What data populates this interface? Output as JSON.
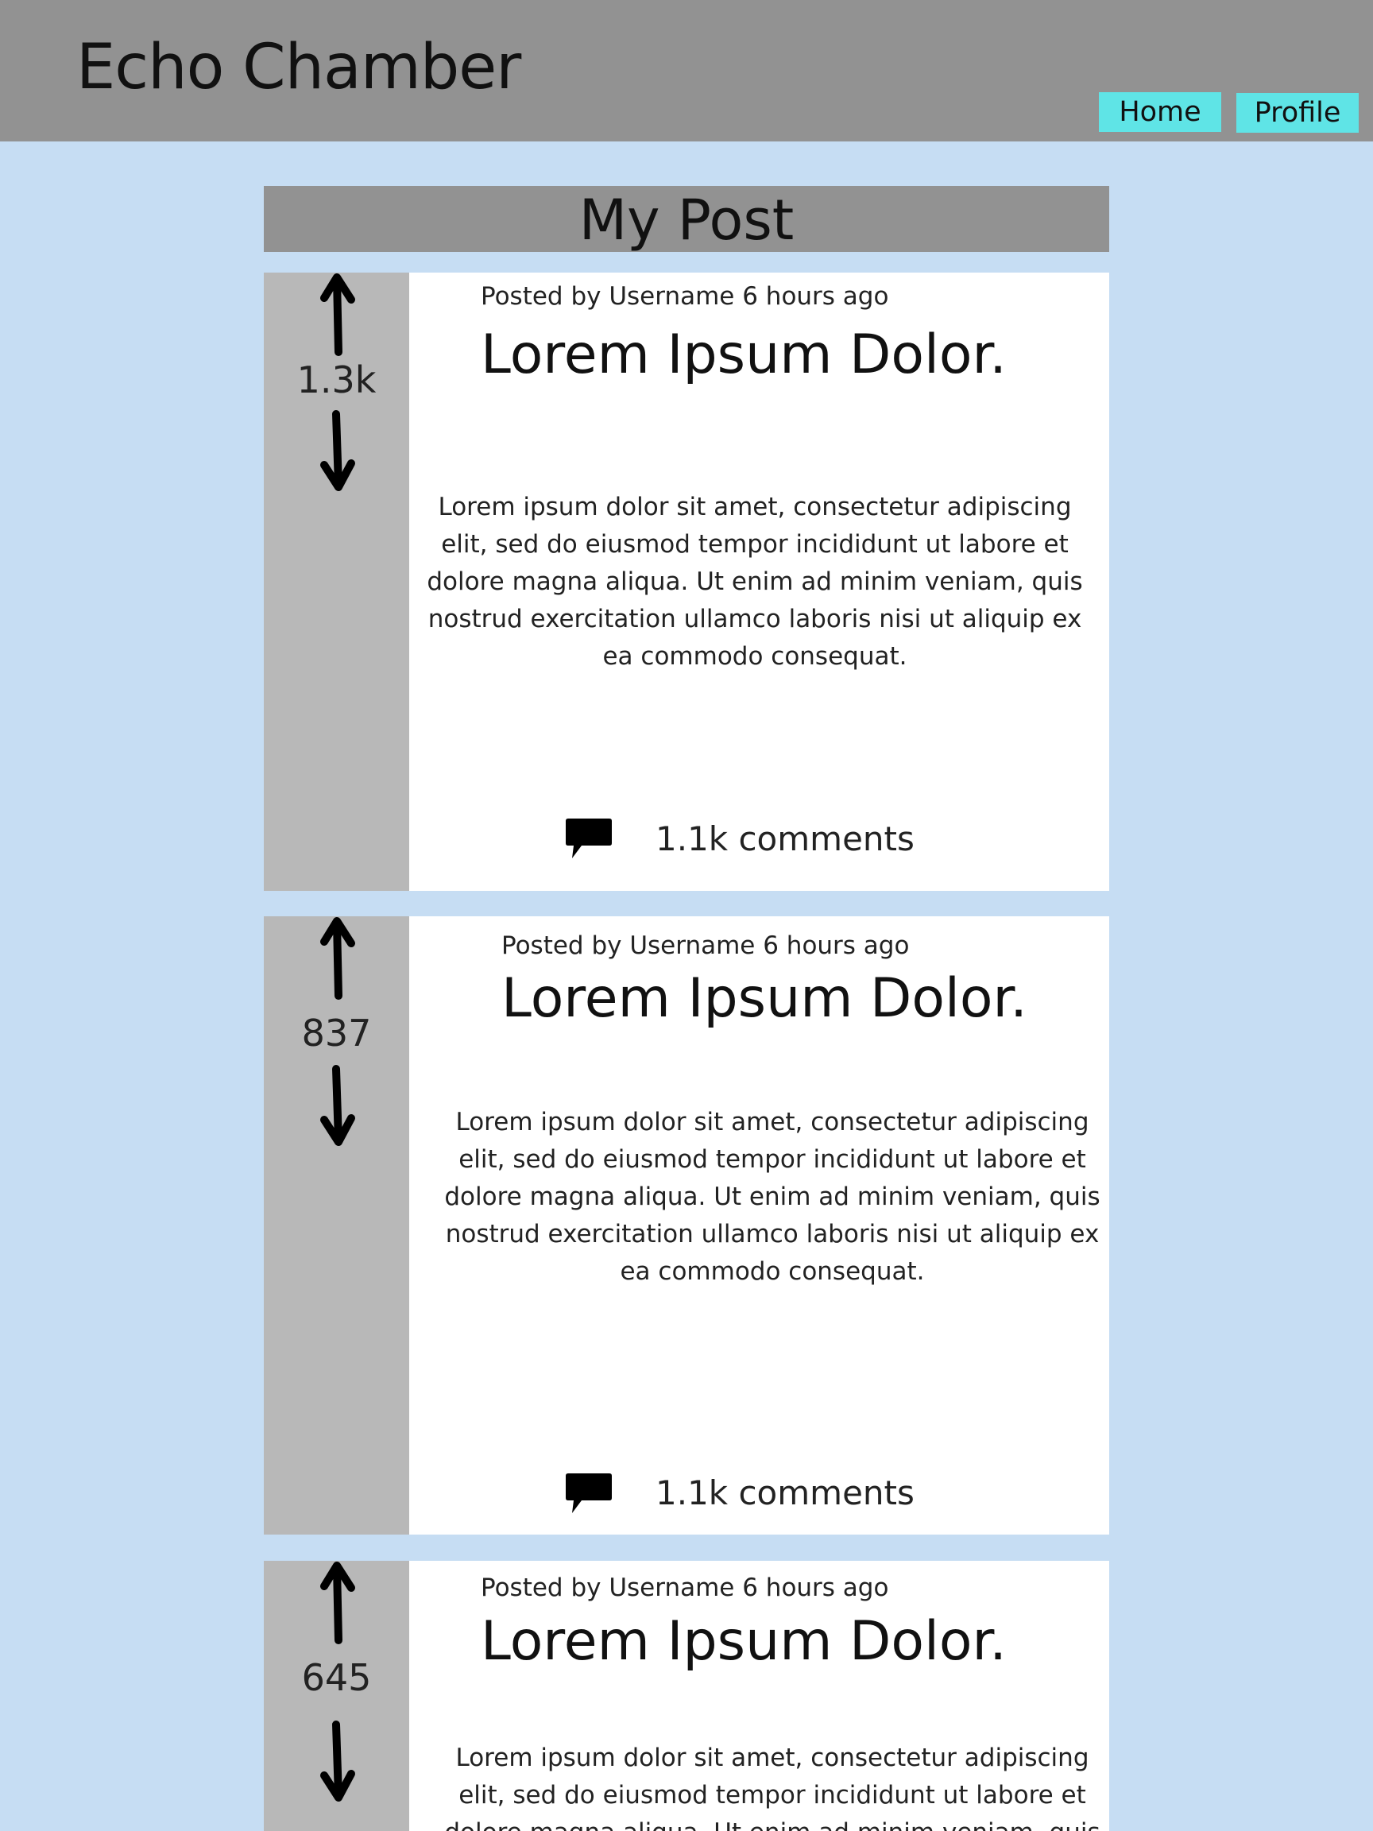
{
  "header": {
    "app_title": "Echo Chamber",
    "nav": [
      {
        "label": "Home"
      },
      {
        "label": "Profile"
      }
    ]
  },
  "page": {
    "title": "My Post"
  },
  "posts": [
    {
      "votes": "1.3k",
      "meta": "Posted by Username 6 hours ago",
      "title": "Lorem Ipsum Dolor.",
      "body": "Lorem ipsum dolor sit amet, consectetur adipiscing elit, sed do eiusmod tempor incididunt ut labore et dolore magna aliqua. Ut enim ad minim veniam, quis nostrud exercitation ullamco laboris nisi ut aliquip ex ea commodo consequat.",
      "comments": "1.1k comments"
    },
    {
      "votes": "837",
      "meta": "Posted by Username 6 hours ago",
      "title": "Lorem Ipsum Dolor.",
      "body": "Lorem ipsum dolor sit amet, consectetur adipiscing elit, sed do eiusmod tempor incididunt ut labore et dolore magna aliqua. Ut enim ad minim veniam, quis nostrud exercitation ullamco laboris nisi ut aliquip ex ea commodo consequat.",
      "comments": "1.1k comments"
    },
    {
      "votes": "645",
      "meta": "Posted by Username 6 hours ago",
      "title": "Lorem Ipsum Dolor.",
      "body": "Lorem ipsum dolor sit amet, consectetur adipiscing elit, sed do eiusmod tempor incididunt ut labore et dolore magna aliqua. Ut enim ad minim veniam, quis",
      "comments": ""
    }
  ],
  "icons": {
    "upvote": "arrow-up-icon",
    "downvote": "arrow-down-icon",
    "comment": "speech-bubble-icon"
  },
  "colors": {
    "page_background": "#c6ddf3",
    "header_background": "#929292",
    "vote_column": "#b8b8b8",
    "nav_button": "#5fe4e6",
    "card_background": "#ffffff"
  }
}
